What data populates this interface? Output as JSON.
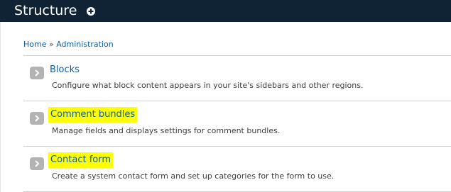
{
  "header": {
    "title": "Structure",
    "shortcut_icon": "plus-circle-icon"
  },
  "breadcrumb": {
    "home": "Home",
    "separator": "»",
    "admin": "Administration"
  },
  "items": [
    {
      "title": "Blocks",
      "description": "Configure what block content appears in your site's sidebars and other regions.",
      "highlighted": false
    },
    {
      "title": "Comment bundles",
      "description": "Manage fields and displays settings for comment bundles.",
      "highlighted": true
    },
    {
      "title": "Contact form",
      "description": "Create a system contact form and set up categories for the form to use.",
      "highlighted": true
    }
  ],
  "colors": {
    "header_bg": "#0f2334",
    "link": "#0b5fa5",
    "highlight": "#ffff00"
  }
}
